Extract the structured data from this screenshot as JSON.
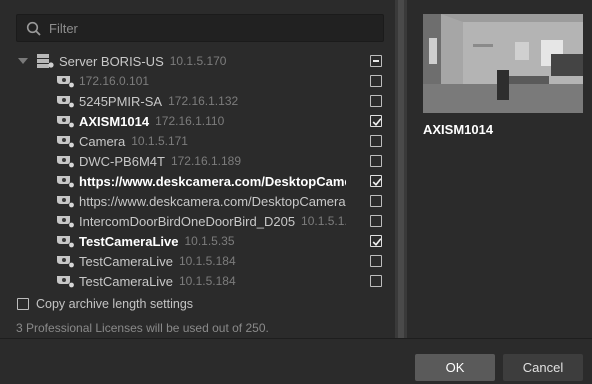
{
  "search": {
    "placeholder": "Filter"
  },
  "server": {
    "name": "Server BORIS-US",
    "ip": "10.1.5.170",
    "state": "partial"
  },
  "cameras": [
    {
      "name": "",
      "ip": "172.16.0.101",
      "checked": false,
      "style": "dim"
    },
    {
      "name": "5245PMIR-SA",
      "ip": "172.16.1.132",
      "checked": false,
      "style": "normal"
    },
    {
      "name": "AXISM1014",
      "ip": "172.16.1.110",
      "checked": true,
      "style": "bold"
    },
    {
      "name": "Camera",
      "ip": "10.1.5.171",
      "checked": false,
      "style": "normal"
    },
    {
      "name": "DWC-PB6M4T",
      "ip": "172.16.1.189",
      "checked": false,
      "style": "normal"
    },
    {
      "name": "https://www.deskcamera.com/DesktopCamera",
      "ip": "",
      "checked": true,
      "style": "bold"
    },
    {
      "name": "https://www.deskcamera.com/DesktopCamera",
      "ip": "",
      "checked": false,
      "style": "normal"
    },
    {
      "name": "IntercomDoorBirdOneDoorBird_D205",
      "ip": "10.1.5.1...",
      "checked": false,
      "style": "normal"
    },
    {
      "name": "TestCameraLive",
      "ip": "10.1.5.35",
      "checked": true,
      "style": "bold"
    },
    {
      "name": "TestCameraLive",
      "ip": "10.1.5.184",
      "checked": false,
      "style": "normal"
    },
    {
      "name": "TestCameraLive",
      "ip": "10.1.5.184",
      "checked": false,
      "style": "normal"
    }
  ],
  "copy_archive": {
    "label": "Copy archive length settings",
    "checked": false
  },
  "license_text": "3 Professional Licenses will be used out of 250.",
  "preview": {
    "camera_name": "AXISM1014"
  },
  "buttons": {
    "ok": "OK",
    "cancel": "Cancel"
  },
  "icons": {
    "search": "search-icon",
    "server": "server-icon",
    "camera": "camera-icon"
  }
}
